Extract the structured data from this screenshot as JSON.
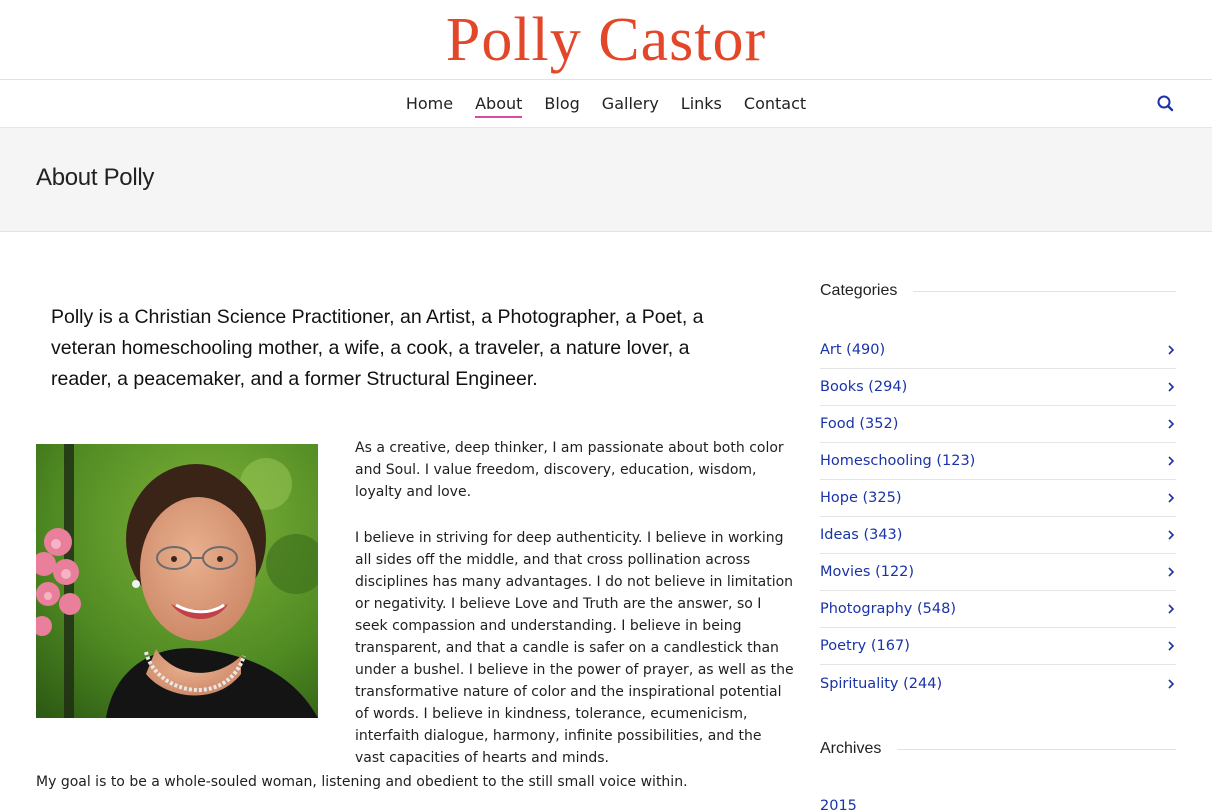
{
  "site": {
    "title": "Polly Castor"
  },
  "nav": {
    "items": [
      {
        "label": "Home"
      },
      {
        "label": "About"
      },
      {
        "label": "Blog"
      },
      {
        "label": "Gallery"
      },
      {
        "label": "Links"
      },
      {
        "label": "Contact"
      }
    ],
    "active": "About",
    "search_icon": "search-icon"
  },
  "page": {
    "title": "About Polly"
  },
  "content": {
    "intro": "Polly is a Christian Science Practitioner, an Artist, a Photographer, a Poet, a veteran homeschooling mother, a wife, a cook, a traveler, a nature lover, a reader, a peacemaker, and a former Structural Engineer.",
    "bio_paragraphs": [
      "As a creative, deep thinker, I am passionate about both color and Soul. I value freedom, discovery, education, wisdom, loyalty and love.",
      "I believe in striving for deep authenticity. I believe in working all sides off the middle, and that cross pollination across disciplines has many advantages. I do not believe in limitation or negativity. I believe Love and Truth are the answer, so I seek compassion and understanding. I believe in being transparent, and that a candle is safer on a candlestick than under a bushel. I believe in the power of prayer, as well as the transformative nature of color and the inspirational potential of words. I believe in kindness, tolerance, ecumenicism, interfaith dialogue, harmony, infinite possibilities, and the vast capacities of hearts and minds."
    ],
    "goal": "My goal is to be a whole-souled woman, listening and obedient to the still small voice within."
  },
  "sidebar": {
    "categories_title": "Categories",
    "categories": [
      {
        "label": "Art (490)"
      },
      {
        "label": "Books (294)"
      },
      {
        "label": "Food (352)"
      },
      {
        "label": "Homeschooling (123)"
      },
      {
        "label": "Hope (325)"
      },
      {
        "label": "Ideas (343)"
      },
      {
        "label": "Movies (122)"
      },
      {
        "label": "Photography (548)"
      },
      {
        "label": "Poetry (167)"
      },
      {
        "label": "Spirituality (244)"
      }
    ],
    "archives_title": "Archives",
    "archives": [
      {
        "label": "2015"
      }
    ]
  },
  "colors": {
    "title": "#e2472a",
    "link": "#1a33a8",
    "active_underline": "#d84aa3"
  }
}
